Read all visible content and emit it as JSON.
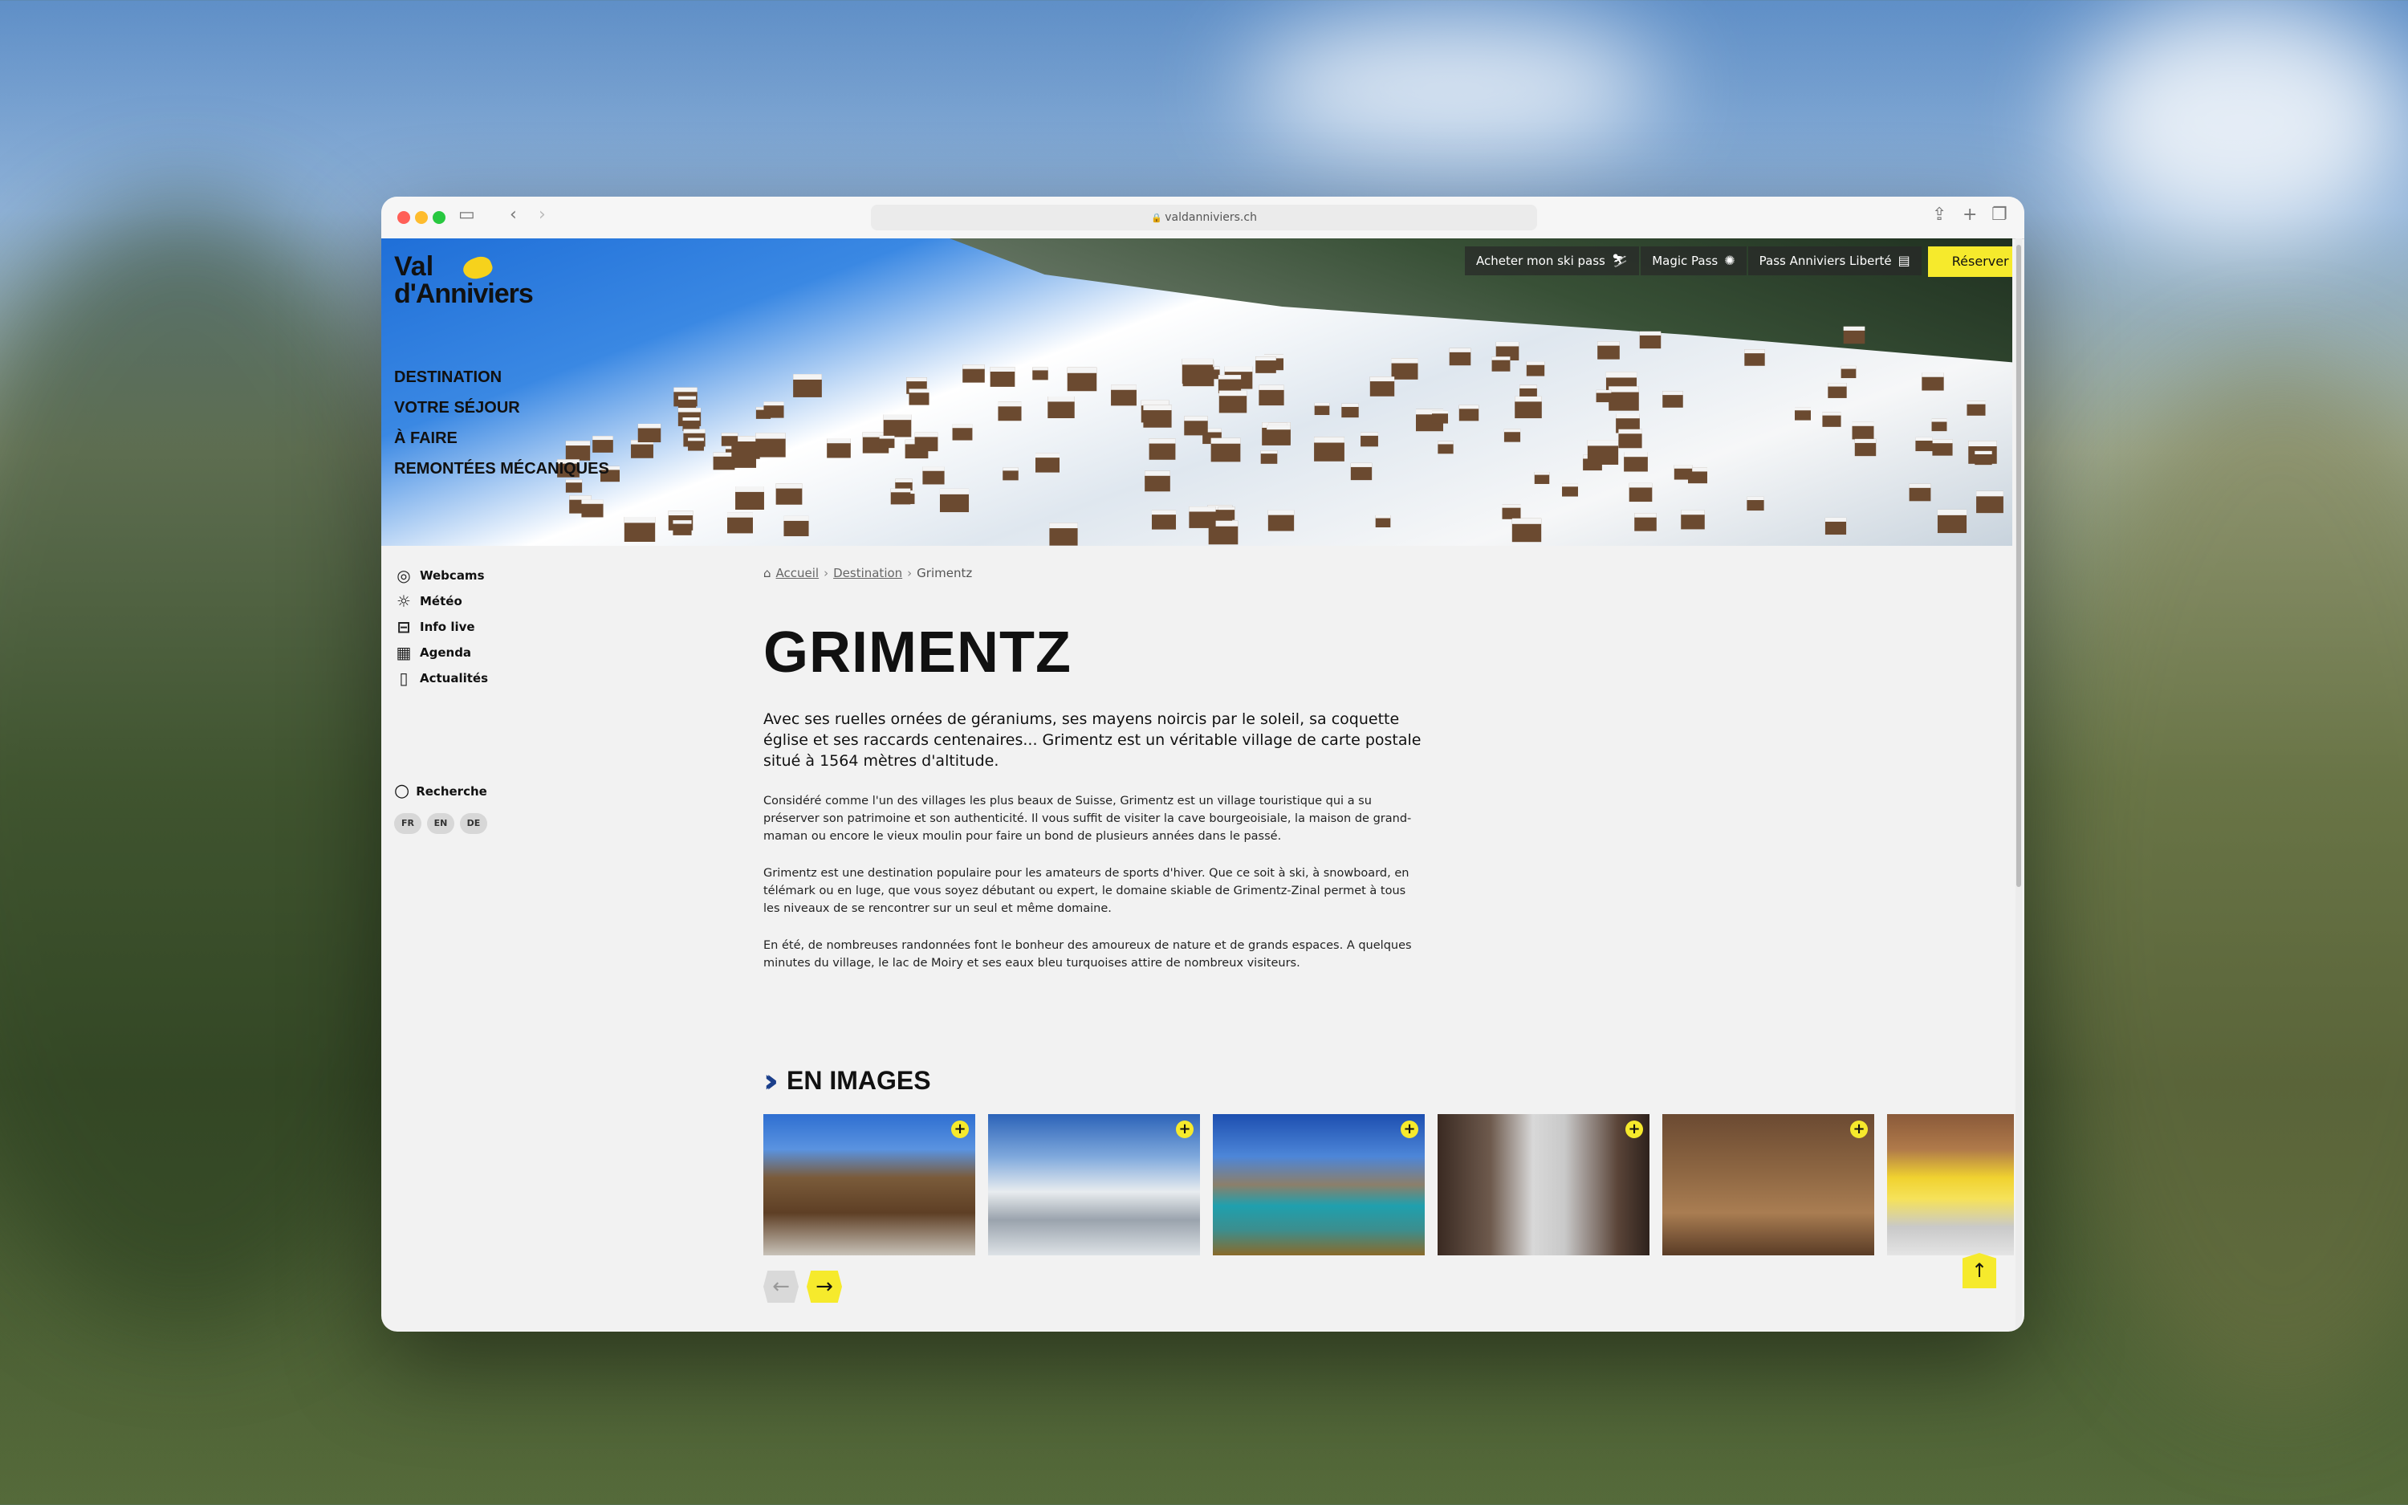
{
  "browser": {
    "url": "valdanniviers.ch"
  },
  "site": {
    "logo_line1": "Val",
    "logo_line2": "d'Anniviers"
  },
  "main_nav": [
    "Destination",
    "Votre séjour",
    "À faire",
    "Remontées mécaniques"
  ],
  "top_links": {
    "ski_pass": "Acheter mon ski pass",
    "magic_pass": "Magic Pass",
    "pass_anniviers": "Pass Anniviers Liberté",
    "reserver": "Réserver"
  },
  "side_nav": [
    {
      "label": "Webcams",
      "icon": "webcam-icon"
    },
    {
      "label": "Météo",
      "icon": "sun-icon"
    },
    {
      "label": "Info live",
      "icon": "cable-car-icon"
    },
    {
      "label": "Agenda",
      "icon": "calendar-icon"
    },
    {
      "label": "Actualités",
      "icon": "book-icon"
    }
  ],
  "search_label": "Recherche",
  "languages": [
    "FR",
    "EN",
    "DE"
  ],
  "breadcrumb": {
    "home": "Accueil",
    "section": "Destination",
    "current": "Grimentz"
  },
  "page": {
    "title": "Grimentz",
    "lead": "Avec ses ruelles ornées de géraniums, ses mayens noircis par le soleil, sa coquette église et ses raccards centenaires... Grimentz est un véritable village de carte postale situé à 1564 mètres d'altitude.",
    "paragraphs": [
      "Considéré comme l'un des villages les plus beaux de Suisse, Grimentz est un village touristique qui a su préserver son patrimoine et son authenticité. Il vous suffit de visiter la cave bourgeoisiale, la maison de grand-maman ou encore le vieux moulin pour faire un bond de plusieurs années dans le passé.",
      "Grimentz est une destination populaire pour les amateurs de sports d'hiver. Que ce soit à ski, à snowboard, en télémark ou en luge, que vous soyez débutant ou expert, le domaine skiable de Grimentz-Zinal permet à tous les niveaux de se rencontrer sur un seul et même domaine.",
      "En été, de nombreuses randonnées font le bonheur des amoureux de nature et de grands espaces. A quelques minutes du village, le lac de Moiry et ses eaux bleu turquoises attire de nombreux visiteurs."
    ]
  },
  "gallery": {
    "title": "En images",
    "plus_label": "+",
    "images": [
      "village-chalets",
      "snowy-mountains",
      "lake-moiry",
      "winter-street",
      "wooden-interior",
      "yellow-umbrellas"
    ]
  },
  "controls": {
    "prev": "←",
    "next": "→",
    "to_top": "↑"
  },
  "colors": {
    "accent_yellow": "#f6ea2c",
    "navy": "#1b3f8b",
    "background": "#f2f2f2"
  }
}
